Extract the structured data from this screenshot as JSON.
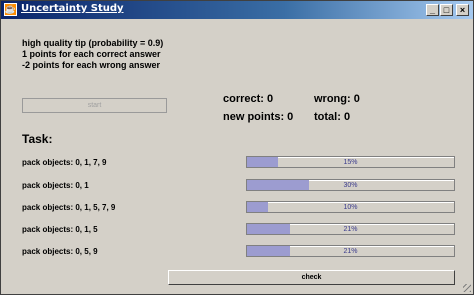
{
  "window": {
    "title": "Uncertainty Study",
    "icon": "java-cup-icon",
    "controls": {
      "minimize": "_",
      "maximize": "□",
      "close": "×"
    }
  },
  "info": {
    "line1": "high quality tip (probability = 0.9)",
    "line2": "1 points for each correct answer",
    "line3": "-2 points for each wrong answer"
  },
  "start_label": "start",
  "score": {
    "correct": "correct: 0",
    "wrong": "wrong: 0",
    "new_points": "new points: 0",
    "total": "total: 0"
  },
  "task_title": "Task:",
  "tasks": [
    {
      "label": "pack objects: 0, 1, 7, 9",
      "progress": 0.15,
      "progress_text": "15%"
    },
    {
      "label": "pack objects: 0, 1",
      "progress": 0.3,
      "progress_text": "30%"
    },
    {
      "label": "pack objects: 0, 1, 5, 7, 9",
      "progress": 0.1,
      "progress_text": "10%"
    },
    {
      "label": "pack objects: 0, 1, 5",
      "progress": 0.21,
      "progress_text": "21%"
    },
    {
      "label": "pack objects: 0, 5, 9",
      "progress": 0.21,
      "progress_text": "21%"
    }
  ],
  "check_label": "check",
  "colors": {
    "bar_fill": "#9c9cd0",
    "bar_text": "#3a3a8c",
    "titlebar": "#0a246a"
  }
}
